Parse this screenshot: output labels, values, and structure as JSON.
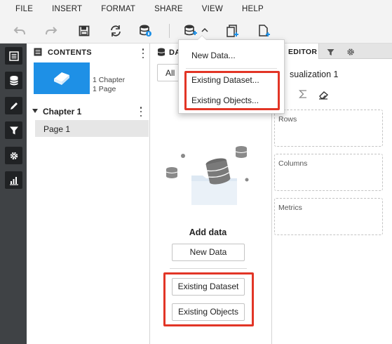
{
  "menu": [
    "FILE",
    "INSERT",
    "FORMAT",
    "SHARE",
    "VIEW",
    "HELP"
  ],
  "toolbar": {
    "icons": [
      "undo-icon",
      "redo-icon",
      "save-icon",
      "refresh-icon",
      "data-settings-icon",
      "add-data-icon",
      "add-chapter-icon",
      "add-page-icon"
    ],
    "accent": "#1e90e6"
  },
  "rail": {
    "icons": [
      "contents-icon",
      "datasets-icon",
      "format-icon",
      "filter-icon",
      "settings-icon",
      "chart-icon"
    ]
  },
  "contents": {
    "title": "CONTENTS",
    "chapter_count": "1 Chapter",
    "page_count": "1 Page",
    "chapter": "Chapter 1",
    "page": "Page 1"
  },
  "datasets": {
    "title": "DA",
    "filter": "All",
    "add_title": "Add data",
    "new_data": "New Data",
    "existing_dataset": "Existing Dataset",
    "existing_objects": "Existing Objects"
  },
  "editor": {
    "tab_label": "EDITOR",
    "viz_title": "sualization 1",
    "zones": [
      "Rows",
      "Columns",
      "Metrics"
    ]
  },
  "dropdown": {
    "items": [
      "New Data...",
      "Existing Dataset...",
      "Existing Objects..."
    ]
  },
  "colors": {
    "highlight": "#e23526",
    "rail": "#3f4245",
    "thumb": "#1e90e6"
  }
}
